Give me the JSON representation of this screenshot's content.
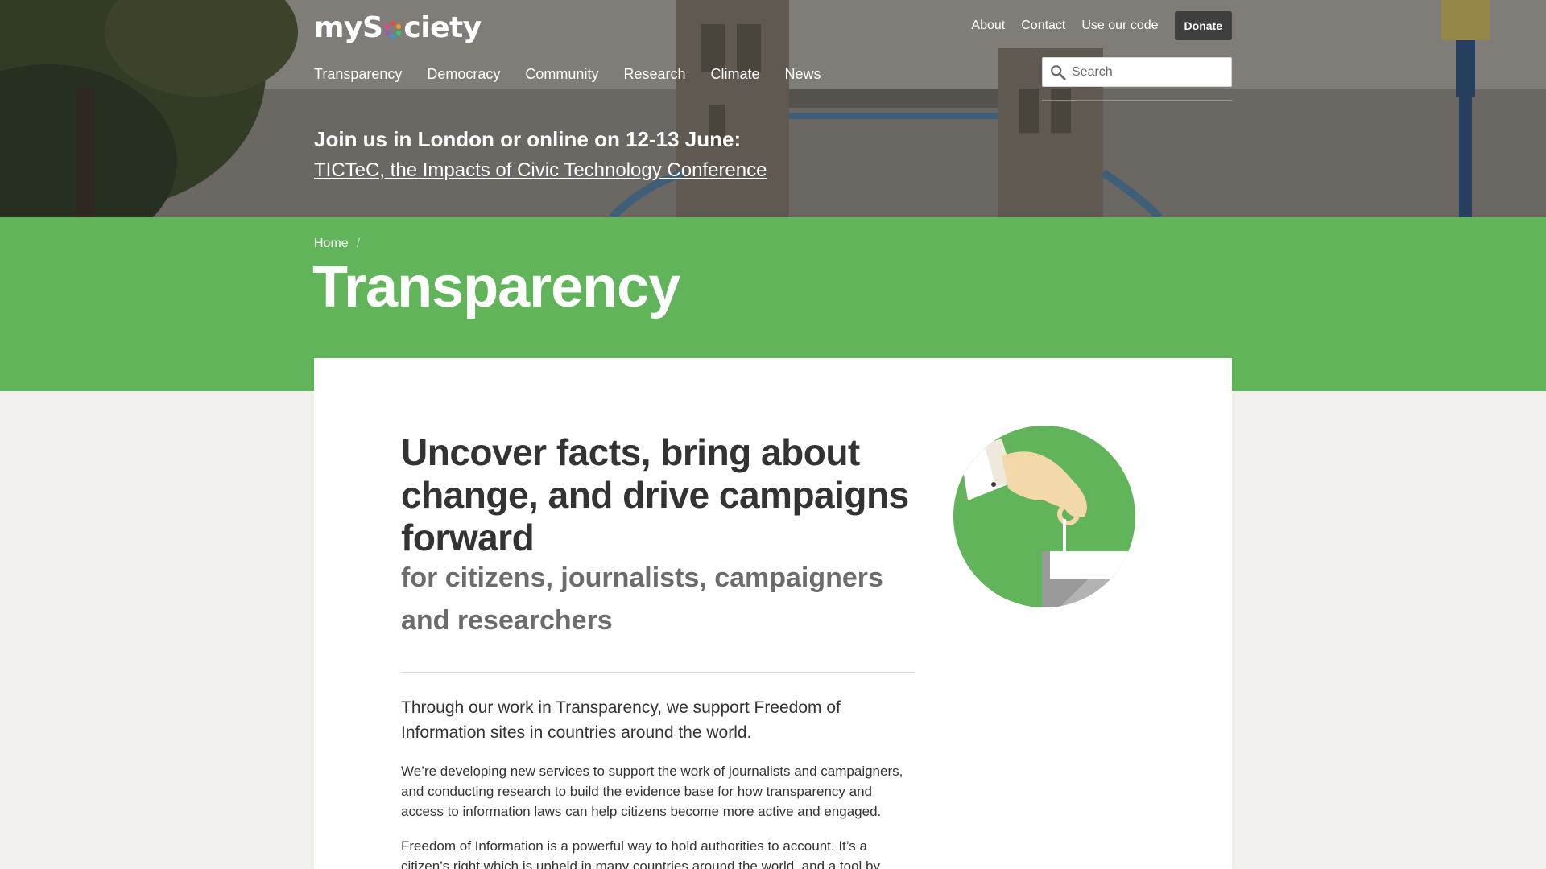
{
  "brand": {
    "logo_text": "mySociety"
  },
  "utility_nav": {
    "about": "About",
    "contact": "Contact",
    "code": "Use our code",
    "donate": "Donate"
  },
  "main_nav": [
    "Transparency",
    "Democracy",
    "Community",
    "Research",
    "Climate",
    "News"
  ],
  "search": {
    "placeholder": "Search"
  },
  "promo": {
    "title": "Join us in London or online on 12-13 June:",
    "link": "TICTeC, the Impacts of Civic Technology Conference"
  },
  "breadcrumb": {
    "home": "Home",
    "separator": "/"
  },
  "page": {
    "title": "Transparency",
    "headline": "Uncover facts, bring about change, and drive campaigns forward",
    "subhead": "for citizens, journalists, campaigners and researchers",
    "lead": "Through our work in Transparency, we support Freedom of Information sites in countries around the world.",
    "paragraphs": [
      "We’re developing new services to support the work of journalists and campaigners, and conducting research to build the evidence base for how transparency and access to information laws can help citizens become more active and engaged.",
      "Freedom of Information is a powerful way to hold authorities to account. It’s a citizen’s right which is upheld in many countries around the world, and a tool by"
    ]
  },
  "icons": {
    "search": "search-icon",
    "illustration": "ballot-hand-illustration",
    "logo_mark": "logo-color-ring-icon"
  },
  "colors": {
    "green_band": "#61b459",
    "page_bg": "#f2f0ec",
    "donate_bg": "#3f3f3f",
    "headline": "#333333",
    "subhead": "#6c6c6c"
  }
}
